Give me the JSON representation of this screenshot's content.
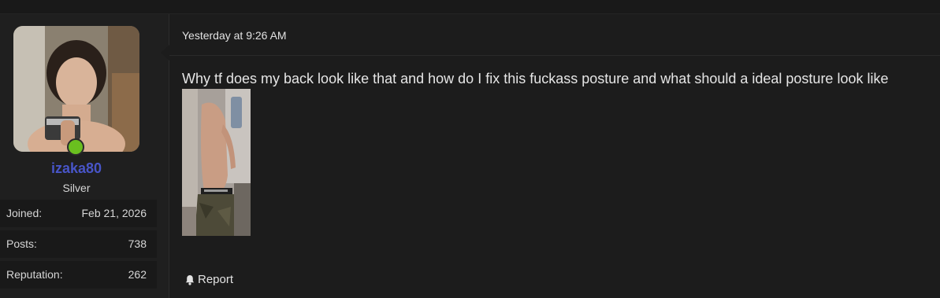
{
  "user": {
    "username": "izaka80",
    "rank": "Silver",
    "status_color": "#6abf1f",
    "username_color": "#4855c8",
    "stats": [
      {
        "label": "Joined:",
        "value": "Feb 21, 2026"
      },
      {
        "label": "Posts:",
        "value": "738"
      },
      {
        "label": "Reputation:",
        "value": "262"
      }
    ]
  },
  "post": {
    "date": "Yesterday at 9:26 AM",
    "text": "Why tf does my back look like that and how do I fix this fuckass posture and what should a ideal posture look like",
    "attachment_icon": "photo-thumbnail"
  },
  "actions": {
    "report_label": "Report",
    "report_icon": "bell-icon"
  }
}
